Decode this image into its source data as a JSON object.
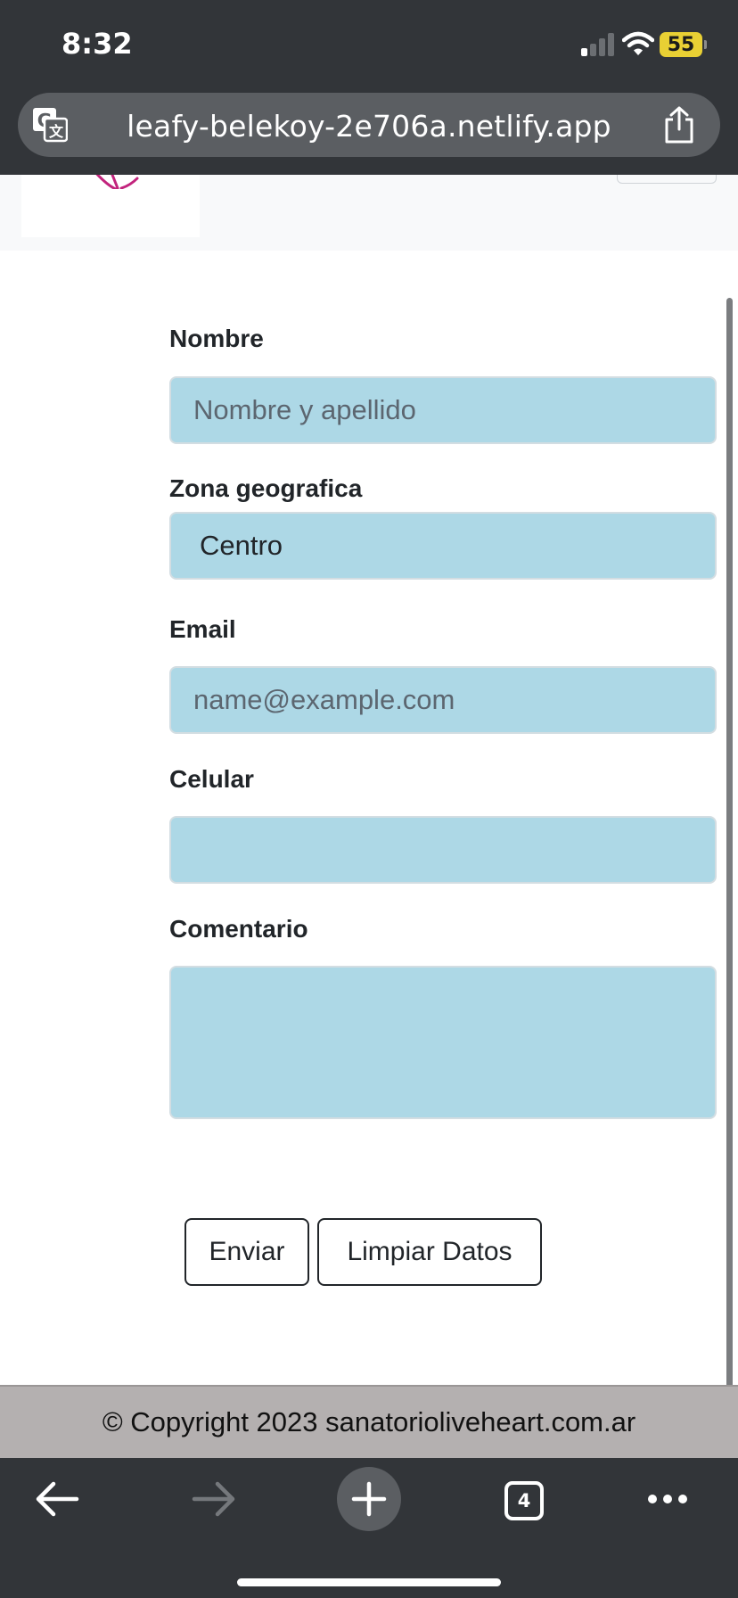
{
  "status_bar": {
    "time": "8:32",
    "battery": "55"
  },
  "browser": {
    "url": "leafy-belekoy-2e706a.netlify.app",
    "tab_count": "4"
  },
  "form": {
    "nombre": {
      "label": "Nombre",
      "placeholder": "Nombre y apellido"
    },
    "zona": {
      "label": "Zona geografica",
      "value": "Centro"
    },
    "email": {
      "label": "Email",
      "placeholder": "name@example.com"
    },
    "celular": {
      "label": "Celular",
      "value": ""
    },
    "comentario": {
      "label": "Comentario",
      "value": ""
    },
    "submit_label": "Enviar",
    "clear_label": "Limpiar Datos"
  },
  "footer": {
    "text": "© Copyright 2023 sanatorioliveheart.com.ar"
  },
  "colors": {
    "field_background": "#add8e6",
    "footer_background": "#b4b0b0",
    "browser_chrome": "#323539",
    "logo_accent": "#c2247d"
  },
  "icons": {
    "translate": "translate-icon",
    "share": "share-icon",
    "back": "back-arrow-icon",
    "forward": "forward-arrow-icon",
    "new_tab": "plus-icon",
    "tabs": "tabs-icon",
    "more": "more-icon"
  }
}
